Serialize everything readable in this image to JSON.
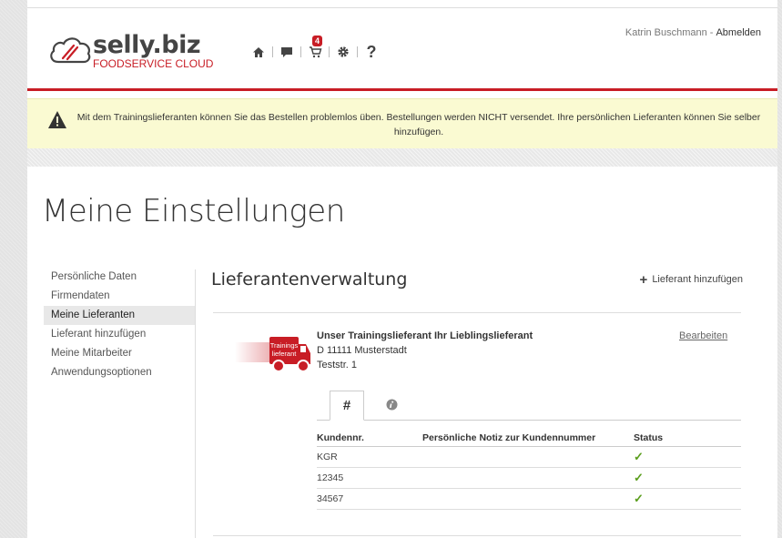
{
  "brand": {
    "name": "selly.biz",
    "subtitle": "FOODSERVICE CLOUD",
    "color": "#c81d25"
  },
  "nav": {
    "icons": [
      "home-icon",
      "chat-icon",
      "cart-icon",
      "gear-icon",
      "help-icon"
    ],
    "cart_badge": "4",
    "help_label": "?"
  },
  "user": {
    "name": "Katrin Buschmann",
    "separator": "-",
    "logout_label": "Abmelden"
  },
  "notice": {
    "text": "Mit dem Trainingslieferanten können Sie das Bestellen problemlos üben. Bestellungen werden NICHT versendet. Ihre persönlichen Lieferanten können Sie selber hinzufügen.",
    "background": "#fafad2"
  },
  "page": {
    "title": "Meine Einstellungen"
  },
  "sidebar": {
    "items": [
      {
        "label": "Persönliche Daten"
      },
      {
        "label": "Firmendaten"
      },
      {
        "label": "Meine Lieferanten",
        "active": true
      },
      {
        "label": "Lieferant hinzufügen"
      },
      {
        "label": "Meine Mitarbeiter"
      },
      {
        "label": "Anwendungsoptionen"
      }
    ]
  },
  "main": {
    "section_title": "Lieferantenverwaltung",
    "add_label": "Lieferant hinzufügen",
    "supplier": {
      "logo_text_1": "Trainings",
      "logo_text_2": "lieferant",
      "name": "Unser Trainingslieferant Ihr Lieblingslieferant",
      "city": "D 11111 Musterstadt",
      "street": "Teststr. 1",
      "edit_label": "Bearbeiten"
    },
    "tabs": [
      {
        "label": "#",
        "active": true
      },
      {
        "label": "info-icon",
        "active": false
      }
    ],
    "table": {
      "headers": [
        "Kundennr.",
        "Persönliche Notiz zur Kundennummer",
        "Status"
      ],
      "rows": [
        {
          "customer_no": "KGR",
          "note": "",
          "status": "✓"
        },
        {
          "customer_no": "12345",
          "note": "",
          "status": "✓"
        },
        {
          "customer_no": "34567",
          "note": "",
          "status": "✓"
        }
      ],
      "status_color": "#5a9e1c"
    }
  }
}
